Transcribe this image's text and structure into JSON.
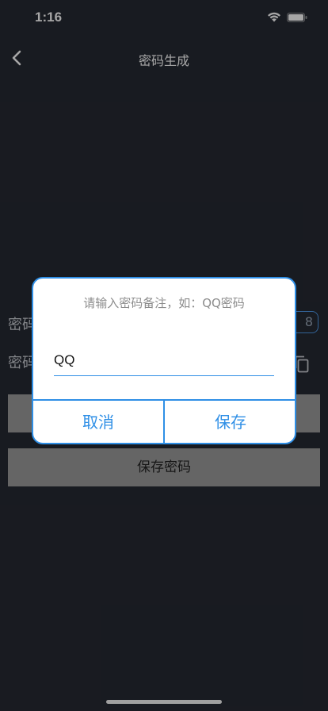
{
  "status_bar": {
    "time": "1:16"
  },
  "nav": {
    "title": "密码生成"
  },
  "background": {
    "label_1": "密码",
    "label_2": "密码",
    "length_value": "8",
    "save_password_label": "保存密码"
  },
  "dialog": {
    "hint": "请输入密码备注，如：QQ密码",
    "input_value": "QQ",
    "cancel_label": "取消",
    "save_label": "保存"
  },
  "colors": {
    "background": "#262a33",
    "accent": "#2f8fe6",
    "button_gray": "#9c9c9c"
  },
  "icons": {
    "back": "chevron-left-icon",
    "wifi": "wifi-icon",
    "battery": "battery-icon",
    "copy": "copy-icon"
  }
}
